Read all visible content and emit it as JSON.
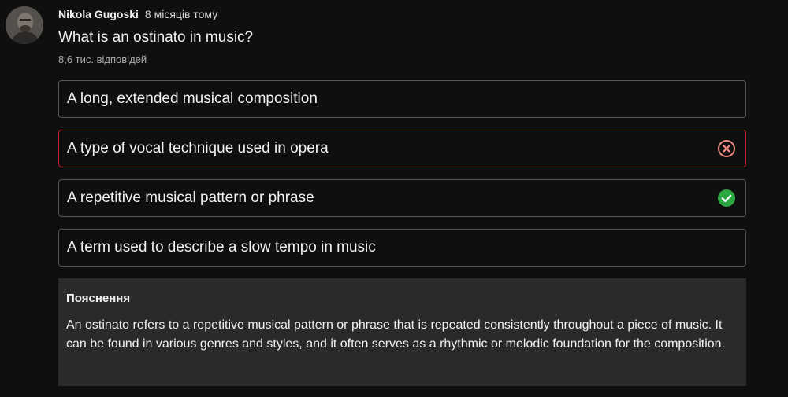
{
  "post": {
    "author": "Nikola Gugoski",
    "time": "8 місяців тому",
    "question": "What is an ostinato in music?",
    "answers_count": "8,6 тис. відповідей"
  },
  "options": [
    {
      "text": "A long, extended musical composition",
      "state": "neutral"
    },
    {
      "text": "A type of vocal technique used in opera",
      "state": "wrong",
      "icon": "x-circle-icon"
    },
    {
      "text": "A repetitive musical pattern or phrase",
      "state": "correct",
      "icon": "check-circle-icon"
    },
    {
      "text": "A term used to describe a slow tempo in music",
      "state": "neutral"
    }
  ],
  "explanation": {
    "title": "Пояснення",
    "body": "An ostinato refers to a repetitive musical pattern or phrase that is repeated consistently throughout a piece of music. It can be found in various genres and styles, and it often serves as a rhythmic or melodic foundation for the composition."
  },
  "colors": {
    "background": "#0f0f0f",
    "wrong": "#cc1f2b",
    "wrong_icon": "#f28b82",
    "correct": "#2ba640",
    "explanation_bg": "#2a2a2a"
  }
}
